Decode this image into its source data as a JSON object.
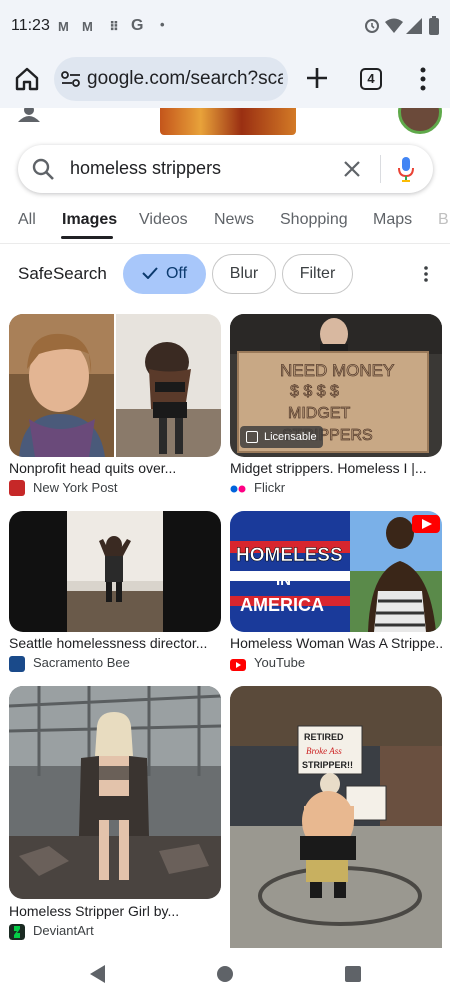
{
  "status_bar": {
    "time": "11:23",
    "notif_icons": [
      "gmail-icon",
      "gmail-icon",
      "grid-icon",
      "google-icon",
      "dot-icon"
    ],
    "right_icons": [
      "alarm-icon",
      "wifi-icon",
      "signal-icon",
      "battery-icon"
    ]
  },
  "browser": {
    "url": "google.com/search?sca_",
    "tab_count": "4"
  },
  "search": {
    "query": "homeless strippers"
  },
  "tabs": [
    {
      "label": "All"
    },
    {
      "label": "Images",
      "active": true
    },
    {
      "label": "Videos"
    },
    {
      "label": "News"
    },
    {
      "label": "Shopping"
    },
    {
      "label": "Maps"
    },
    {
      "label": "B"
    }
  ],
  "safesearch": {
    "label": "SafeSearch",
    "options": [
      "Off",
      "Blur",
      "Filter"
    ],
    "selected": "Off"
  },
  "results": [
    {
      "title": "Nonprofit head quits over...",
      "source": "New York Post",
      "source_icon_color": "#c62828"
    },
    {
      "title": "Midget strippers. Homeless I |...",
      "source": "Flickr",
      "badge": "Licensable"
    },
    {
      "title": "Seattle homelessness director...",
      "source": "Sacramento Bee",
      "source_icon_color": "#1a4a8a"
    },
    {
      "title": "Homeless Woman Was A Strippe...",
      "source": "YouTube",
      "source_icon_color": "#ff0000"
    },
    {
      "title": "Homeless Stripper Girl by...",
      "source": "DeviantArt",
      "source_icon_color": "#05cc47"
    },
    {
      "title": "",
      "source": ""
    }
  ],
  "image_text": {
    "sign": "NEED MONEY $ $ MIDGET STRIPPERS",
    "youtube_thumb": "HOMELESS IN AMERICA",
    "poster": "RETIRED Broke Ass STRIPPER!!"
  }
}
